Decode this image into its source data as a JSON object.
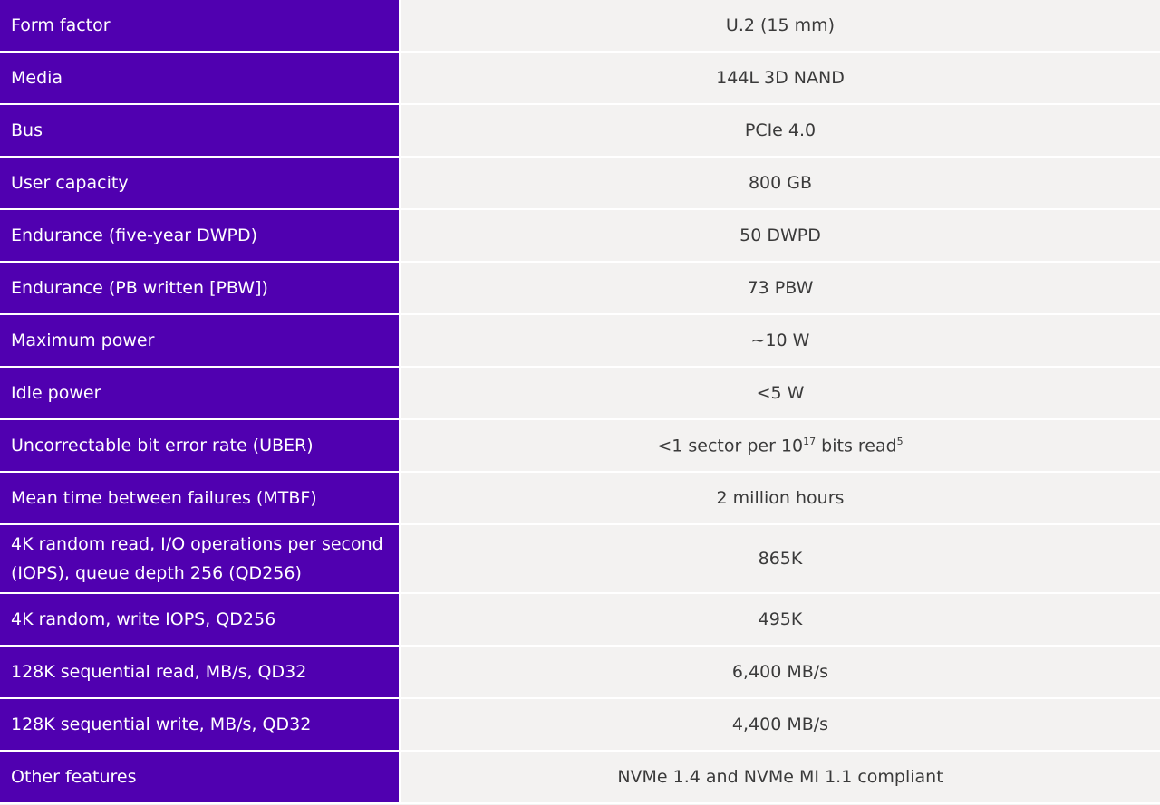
{
  "colors": {
    "label_bg": "#5000b0",
    "value_bg": "#f3f2f1"
  },
  "rows": [
    {
      "label": "Form factor",
      "value": "U.2 (15 mm)"
    },
    {
      "label": "Media",
      "value": "144L 3D NAND"
    },
    {
      "label": "Bus",
      "value": "PCIe 4.0"
    },
    {
      "label": "User capacity",
      "value": "800 GB"
    },
    {
      "label": "Endurance (five-year DWPD)",
      "value": "50 DWPD"
    },
    {
      "label": "Endurance (PB written [PBW])",
      "value": "73 PBW"
    },
    {
      "label": "Maximum power",
      "value": "~10 W"
    },
    {
      "label": "Idle power",
      "value": "<5 W"
    },
    {
      "label": "Uncorrectable bit error rate (UBER)",
      "value_prefix": "<1 sector per 10",
      "value_exponent": "17",
      "value_suffix": " bits read",
      "value_footnote": "5"
    },
    {
      "label": "Mean time between failures (MTBF)",
      "value": "2 million hours"
    },
    {
      "label": "4K random read, I/O operations per second (IOPS), queue depth 256 (QD256)",
      "value": "865K"
    },
    {
      "label": "4K random, write IOPS, QD256",
      "value": "495K"
    },
    {
      "label": "128K sequential read, MB/s, QD32",
      "value": "6,400 MB/s"
    },
    {
      "label": "128K sequential write, MB/s, QD32",
      "value": "4,400 MB/s"
    },
    {
      "label": "Other features",
      "value": "NVMe 1.4 and NVMe MI 1.1 compliant"
    }
  ]
}
